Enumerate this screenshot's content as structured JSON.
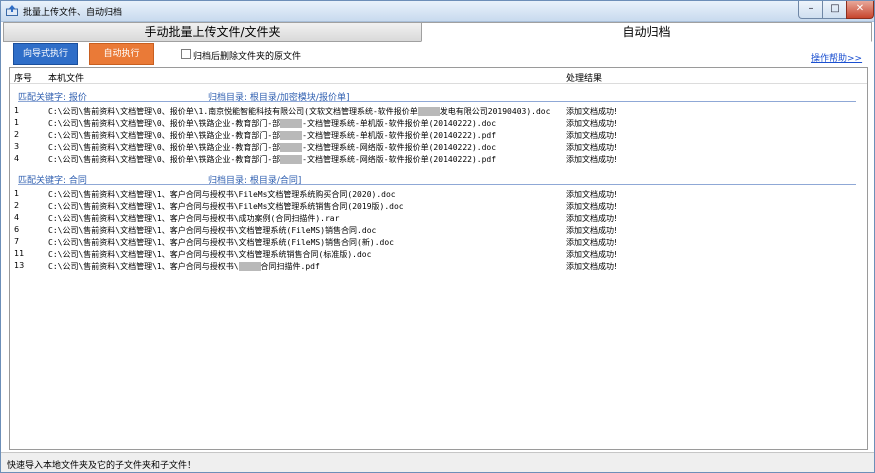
{
  "window": {
    "title": "批量上传文件、自动归档",
    "min_label": "–",
    "max_label": "□",
    "close_label": "✕"
  },
  "tabs": [
    {
      "label": "手动批量上传文件/文件夹",
      "active": false
    },
    {
      "label": "自动归档",
      "active": true
    }
  ],
  "toolbar": {
    "wizard_label": "向导式执行",
    "auto_label": "自动执行",
    "delete_checkbox_label": "归档后删除文件夹的原文件",
    "delete_checked": false,
    "help_label": "操作帮助>>"
  },
  "list": {
    "headers": {
      "seq": "序号",
      "file": "本机文件",
      "result": "处理结果"
    },
    "groups": [
      {
        "keyword": "匹配关键字: 报价",
        "target": "归档目录: 根目录/加密模块/报价单]",
        "rows": [
          {
            "seq": "1",
            "file_pre": "C:\\公司\\售前资料\\文档管理\\0、报价单\\1.南京悦能智能科技有限公司(文软文档管理系统-软件报价单",
            "file_post": "发电有限公司20190403).doc",
            "result": "添加文档成功!"
          },
          {
            "seq": "1",
            "file_pre": "C:\\公司\\售前资料\\文档管理\\0、报价单\\铁路企业-教育部门-部",
            "file_post": "-文档管理系统-单机版-软件报价单(20140222).doc",
            "result": "添加文档成功!"
          },
          {
            "seq": "2",
            "file_pre": "C:\\公司\\售前资料\\文档管理\\0、报价单\\铁路企业-教育部门-部",
            "file_post": "-文档管理系统-单机版-软件报价单(20140222).pdf",
            "result": "添加文档成功!"
          },
          {
            "seq": "3",
            "file_pre": "C:\\公司\\售前资料\\文档管理\\0、报价单\\铁路企业-教育部门-部",
            "file_post": "-文档管理系统-网络版-软件报价单(20140222).doc",
            "result": "添加文档成功!"
          },
          {
            "seq": "4",
            "file_pre": "C:\\公司\\售前资料\\文档管理\\0、报价单\\铁路企业-教育部门-部",
            "file_post": "-文档管理系统-网络版-软件报价单(20140222).pdf",
            "result": "添加文档成功!"
          }
        ]
      },
      {
        "keyword": "匹配关键字: 合同",
        "target": "归档目录: 根目录/合同]",
        "rows": [
          {
            "seq": "1",
            "file_pre": "C:\\公司\\售前资料\\文档管理\\1、客户合同与授权书\\FileMs文档管理系统购买合同(2020).doc",
            "file_post": "",
            "result": "添加文档成功!"
          },
          {
            "seq": "2",
            "file_pre": "C:\\公司\\售前资料\\文档管理\\1、客户合同与授权书\\FileMs文档管理系统销售合同(2019版).doc",
            "file_post": "",
            "result": "添加文档成功!"
          },
          {
            "seq": "4",
            "file_pre": "C:\\公司\\售前资料\\文档管理\\1、客户合同与授权书\\成功案例(合同扫描件).rar",
            "file_post": "",
            "result": "添加文档成功!"
          },
          {
            "seq": "6",
            "file_pre": "C:\\公司\\售前资料\\文档管理\\1、客户合同与授权书\\文档管理系统(FileMS)销售合同.doc",
            "file_post": "",
            "result": "添加文档成功!"
          },
          {
            "seq": "7",
            "file_pre": "C:\\公司\\售前资料\\文档管理\\1、客户合同与授权书\\文档管理系统(FileMS)销售合同(新).doc",
            "file_post": "",
            "result": "添加文档成功!"
          },
          {
            "seq": "11",
            "file_pre": "C:\\公司\\售前资料\\文档管理\\1、客户合同与授权书\\文档管理系统销售合同(标准版).doc",
            "file_post": "",
            "result": "添加文档成功!"
          },
          {
            "seq": "13",
            "file_pre": "C:\\公司\\售前资料\\文档管理\\1、客户合同与授权书\\",
            "file_post": "合同扫描件.pdf",
            "result": "添加文档成功!"
          }
        ]
      }
    ]
  },
  "status": {
    "text": "快速导入本地文件夹及它的子文件夹和子文件！"
  }
}
